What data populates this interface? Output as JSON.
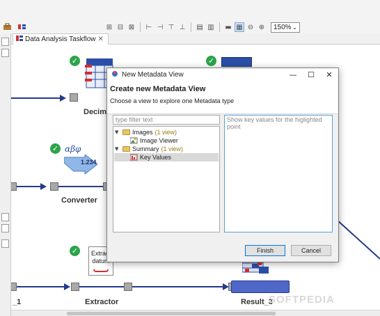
{
  "toolbar": {
    "zoom_value": "150%",
    "icons": [
      "layout-icon",
      "align-icon",
      "distribute-icon",
      "tree-layout-icon",
      "grid-icon",
      "zoom-out-icon",
      "zoom-in-icon"
    ]
  },
  "editor": {
    "tab_label": "Data Analysis Taskflow",
    "tab_close": "✕"
  },
  "canvas": {
    "nodes": {
      "decimal_label": "Decima",
      "converter_label": "Converter",
      "converter_symbol": "αβφ",
      "converter_value": "1.234",
      "extractor_label": "Extractor",
      "extract_icon_text": "Extract datum",
      "result_label": "Result_3",
      "left_label": "_1"
    },
    "colors": {
      "connection": "#243a8c",
      "check": "#2ca44a",
      "result": "#4f67c8"
    }
  },
  "dialog": {
    "window_title": "New Metadata View",
    "heading": "Create new Metadata View",
    "subheading": "Choose a view to explore one Metadata type",
    "filter_placeholder": "type filter text",
    "description_placeholder": "Show key values for the higlighted point",
    "tree": [
      {
        "label": "Images",
        "count": "(1 view)",
        "expanded": true
      },
      {
        "label": "Image Viewer"
      },
      {
        "label": "Summary",
        "count": "(1 view)",
        "expanded": true
      },
      {
        "label": "Key Values",
        "selected": true
      }
    ],
    "finish_label": "Finish",
    "cancel_label": "Cancel"
  },
  "watermark": "SOFTPEDIA"
}
